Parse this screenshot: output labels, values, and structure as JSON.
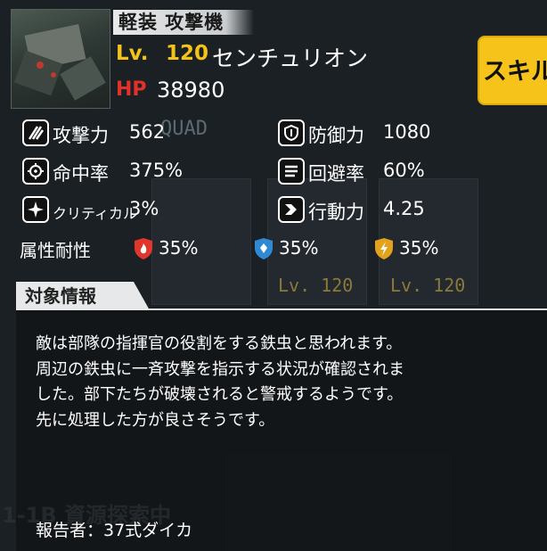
{
  "header": {
    "type_tag": "軽装 攻撃機",
    "level_label": "Lv.",
    "level_value": "120",
    "unit_name": "センチュリオン",
    "hp_label": "HP",
    "hp_value": "38980",
    "skill_button": "スキル"
  },
  "stats": {
    "attack": {
      "label": "攻撃力",
      "value": "562"
    },
    "defense": {
      "label": "防御力",
      "value": "1080"
    },
    "accuracy": {
      "label": "命中率",
      "value": "375%"
    },
    "evasion": {
      "label": "回避率",
      "value": "60%"
    },
    "critical": {
      "label": "クリティカル",
      "value": "3%"
    },
    "action": {
      "label": "行動力",
      "value": "4.25"
    }
  },
  "resistances": {
    "label": "属性耐性",
    "fire": "35%",
    "ice": "35%",
    "lightning": "35%"
  },
  "target_info": {
    "title": "対象情報",
    "lines": [
      "敵は部隊の指揮官の役割をする鉄虫と思われます。",
      "周辺の鉄虫に一斉攻撃を指示する状況が確認されま",
      "した。部下たちが破壊されると警戒するようです。",
      "先に処理した方が良さそうです。"
    ],
    "reporter": "報告者：37式ダイカ"
  },
  "background": {
    "lv_tags": [
      "Lv. 120",
      "Lv. 120"
    ],
    "squad_text": "QUAD",
    "faint_heading": "1-1B 資源探索中"
  },
  "colors": {
    "level": "#f4c318",
    "hp": "#e2312a",
    "skill_button": "#f6c31a",
    "fire": "#e0362c",
    "ice": "#2f8ad3",
    "lightning": "#e3a11c"
  }
}
